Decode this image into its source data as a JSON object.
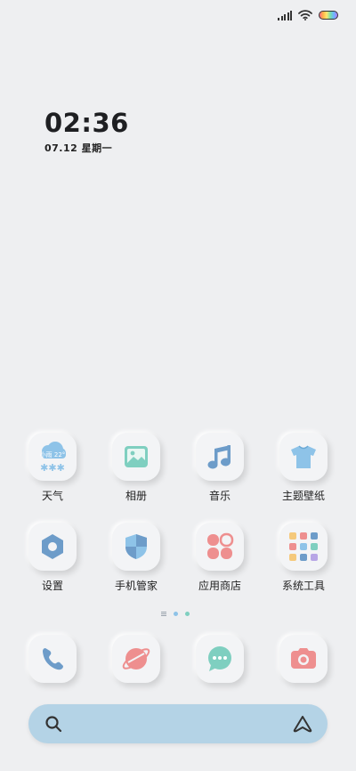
{
  "status_bar": {
    "icons": [
      "signal-icon",
      "wifi-icon",
      "battery-icon"
    ],
    "battery_colors": [
      "#ff6b8a",
      "#ffb347",
      "#ffe66d",
      "#7be0a8",
      "#6ab7ff",
      "#b57bff"
    ]
  },
  "clock": {
    "time": "02:36",
    "date": "07.12 星期一"
  },
  "weather_widget": {
    "text": "小雨 22°"
  },
  "apps": [
    {
      "label": "天气",
      "icon": "weather-icon"
    },
    {
      "label": "相册",
      "icon": "gallery-icon"
    },
    {
      "label": "音乐",
      "icon": "music-icon"
    },
    {
      "label": "主题壁纸",
      "icon": "tshirt-icon"
    },
    {
      "label": "设置",
      "icon": "settings-icon"
    },
    {
      "label": "手机管家",
      "icon": "security-shield-icon"
    },
    {
      "label": "应用商店",
      "icon": "app-store-icon"
    },
    {
      "label": "系统工具",
      "icon": "system-tools-folder-icon"
    }
  ],
  "page_indicator": {
    "pages": 2,
    "current": 1
  },
  "dock": [
    "phone-icon",
    "browser-icon",
    "messages-icon",
    "camera-icon"
  ],
  "search": {
    "left_icon": "search-icon",
    "right_icon": "assistant-icon",
    "color": "#b4d3e6"
  },
  "colors": {
    "background": "#eeeff1",
    "blue": "#6d9cc9",
    "teal": "#7fcfc0",
    "pink": "#ee8f8f",
    "sky": "#8ec3e8"
  }
}
